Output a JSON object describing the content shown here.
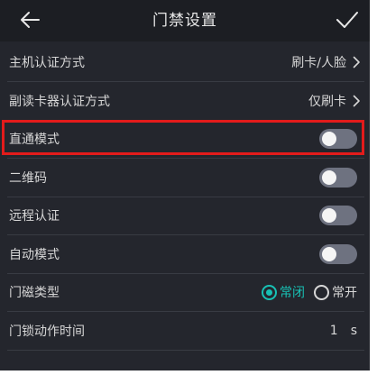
{
  "header": {
    "title": "门禁设置",
    "back_icon": "arrow-left-icon",
    "confirm_icon": "checkmark-icon"
  },
  "settings": {
    "main_auth": {
      "label": "主机认证方式",
      "value": "刷卡/人脸"
    },
    "sub_reader_auth": {
      "label": "副读卡器认证方式",
      "value": "仅刷卡"
    },
    "direct_mode": {
      "label": "直通模式",
      "enabled": false
    },
    "qr_code": {
      "label": "二维码",
      "enabled": false
    },
    "remote_auth": {
      "label": "远程认证",
      "enabled": false
    },
    "auto_mode": {
      "label": "自动模式",
      "enabled": false
    },
    "door_sensor_type": {
      "label": "门磁类型",
      "options": [
        "常闭",
        "常开"
      ],
      "selected": "常闭"
    },
    "lock_action_time": {
      "label": "门锁动作时间",
      "value": "1",
      "unit": "s"
    }
  },
  "colors": {
    "accent": "#18c0b4",
    "highlight_border": "#e31b1b",
    "background": "#24262d",
    "header_background": "#1c1e23"
  }
}
